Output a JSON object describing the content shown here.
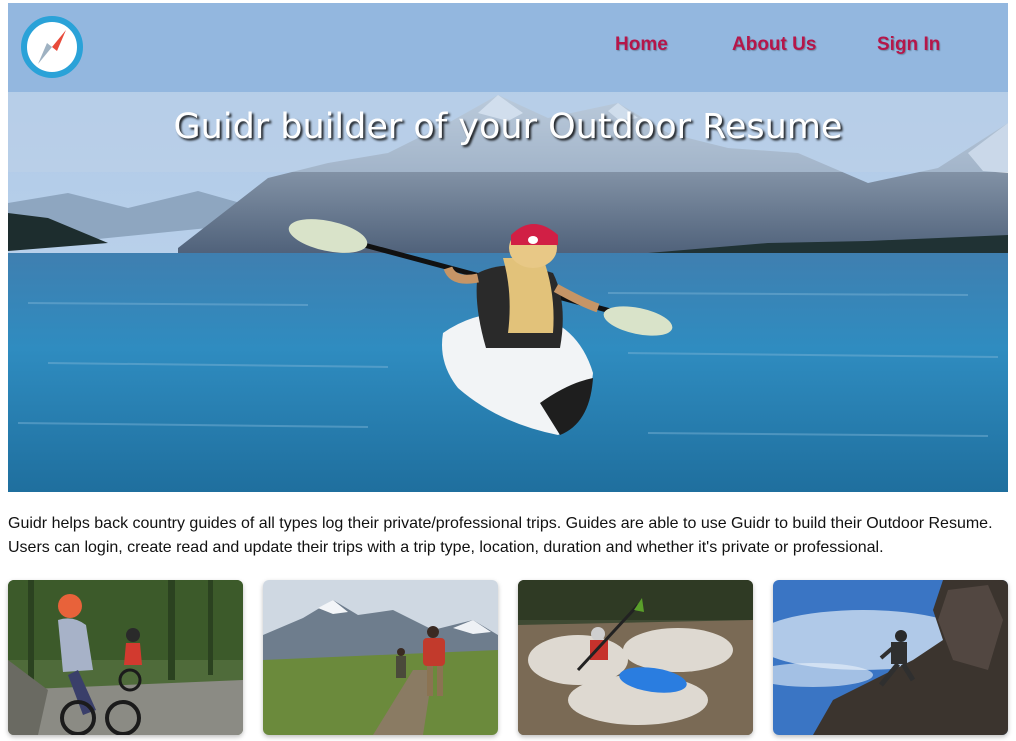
{
  "navbar": {
    "logo_icon": "compass-icon",
    "links": [
      {
        "label": "Home"
      },
      {
        "label": "About Us"
      },
      {
        "label": "Sign In"
      }
    ],
    "link_color": "#b5164a",
    "background_color": "#93b7df"
  },
  "hero": {
    "title": "Guidr builder of your Outdoor Resume",
    "image": "kayaker-on-mountain-lake-photo"
  },
  "description": "Guidr helps back country guides of all types log their private/professional trips. Guides are able to use Guidr to build their Outdoor Resume. Users can login, create read and update their trips with a trip type, location, duration and whether it's private or professional.",
  "cards": [
    {
      "image": "mountain-biking-photo"
    },
    {
      "image": "hiking-photo"
    },
    {
      "image": "whitewater-kayaking-photo"
    },
    {
      "image": "rock-climbing-photo"
    }
  ]
}
